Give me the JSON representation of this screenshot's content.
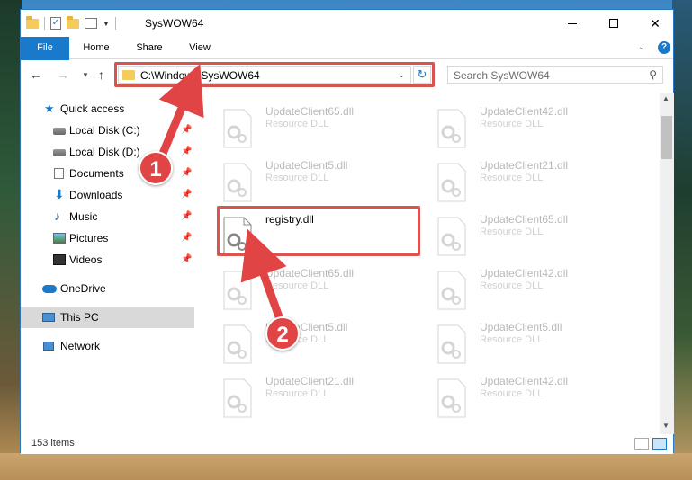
{
  "window": {
    "title": "SysWOW64",
    "minimize_label": "",
    "maximize_label": "",
    "close_label": "✕"
  },
  "ribbon": {
    "tabs": [
      "File",
      "Home",
      "Share",
      "View"
    ]
  },
  "nav": {
    "address": "C:\\Windows\\SysWOW64",
    "search_placeholder": "Search SysWOW64"
  },
  "sidebar": {
    "items": [
      {
        "label": "Quick access"
      },
      {
        "label": "Local Disk (C:)"
      },
      {
        "label": "Local Disk (D:)"
      },
      {
        "label": "Documents"
      },
      {
        "label": "Downloads"
      },
      {
        "label": "Music"
      },
      {
        "label": "Pictures"
      },
      {
        "label": "Videos"
      },
      {
        "label": "OneDrive"
      },
      {
        "label": "This PC"
      },
      {
        "label": "Network"
      }
    ]
  },
  "files": {
    "left": [
      {
        "name": "UpdateClient65.dll",
        "type": "Resource DLL"
      },
      {
        "name": "UpdateClient5.dll",
        "type": "Resource DLL"
      },
      {
        "name": "registry.dll",
        "type": ""
      },
      {
        "name": "UpdateClient65.dll",
        "type": "Resource DLL"
      },
      {
        "name": "UpdateClient5.dll",
        "type": "Resource DLL"
      },
      {
        "name": "UpdateClient21.dll",
        "type": "Resource DLL"
      }
    ],
    "right": [
      {
        "name": "UpdateClient42.dll",
        "type": "Resource DLL"
      },
      {
        "name": "UpdateClient21.dll",
        "type": "Resource DLL"
      },
      {
        "name": "UpdateClient65.dll",
        "type": "Resource DLL"
      },
      {
        "name": "UpdateClient42.dll",
        "type": "Resource DLL"
      },
      {
        "name": "UpdateClient5.dll",
        "type": "Resource DLL"
      },
      {
        "name": "UpdateClient42.dll",
        "type": "Resource DLL"
      }
    ]
  },
  "status": {
    "item_count": "153 items"
  },
  "callouts": [
    "1",
    "2"
  ],
  "colors": {
    "accent": "#1979ca",
    "highlight_red": "#d9534f",
    "callout_red": "#e04444"
  }
}
